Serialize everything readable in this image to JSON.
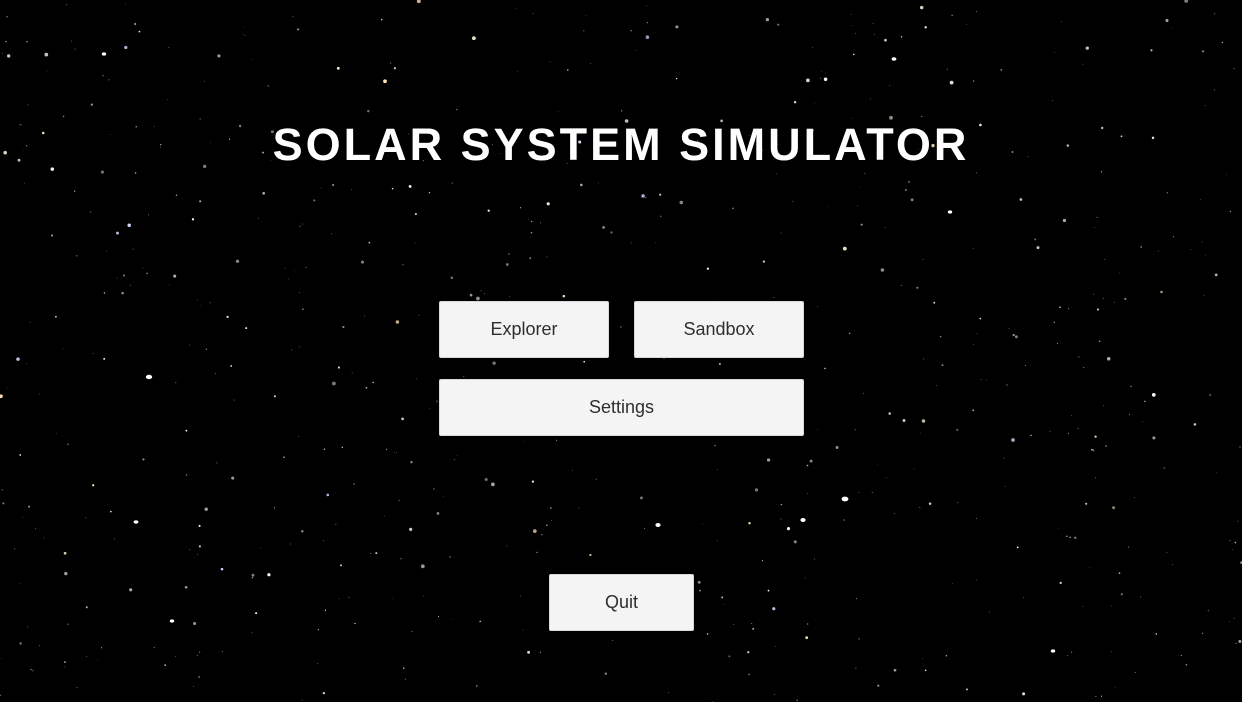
{
  "title": "SOLAR SYSTEM SIMULATOR",
  "menu": {
    "explorer_label": "Explorer",
    "sandbox_label": "Sandbox",
    "settings_label": "Settings",
    "quit_label": "Quit"
  },
  "colors": {
    "background": "#000000",
    "title": "#ffffff",
    "button_fill": "#f4f4f4",
    "button_text": "#2e2e2e"
  }
}
